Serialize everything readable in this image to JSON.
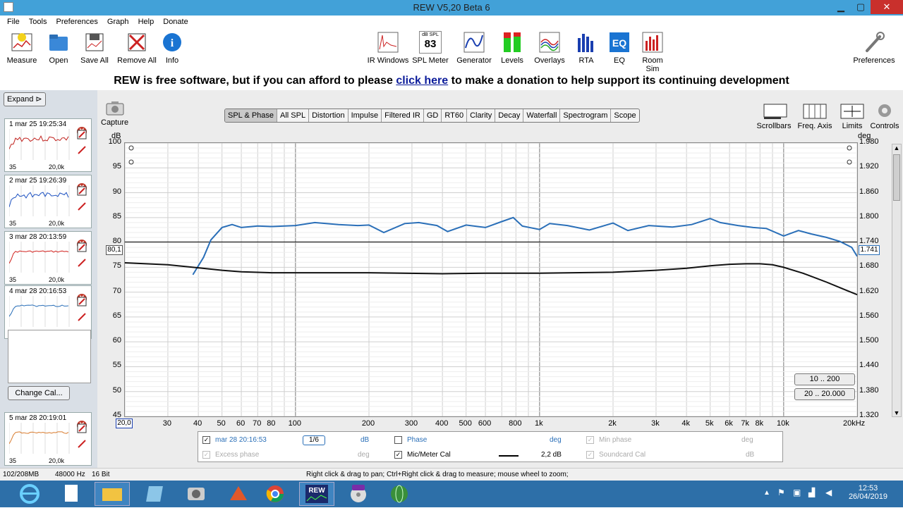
{
  "window": {
    "title": "REW V5,20 Beta 6",
    "minimize": "▁",
    "restore": "▢",
    "close": "✕"
  },
  "menu": [
    "File",
    "Tools",
    "Preferences",
    "Graph",
    "Help",
    "Donate"
  ],
  "toolbar_left": [
    {
      "label": "Measure",
      "icon": "measure-icon"
    },
    {
      "label": "Open",
      "icon": "folder-icon"
    },
    {
      "label": "Save All",
      "icon": "save-icon"
    },
    {
      "label": "Remove All",
      "icon": "remove-all-icon"
    },
    {
      "label": "Info",
      "icon": "info-icon"
    }
  ],
  "toolbar_center": [
    {
      "label": "IR Windows",
      "icon": "ir-windows-icon"
    },
    {
      "label": "SPL Meter",
      "icon": "spl-meter-icon",
      "display_top": "dB SPL",
      "display_value": "83"
    },
    {
      "label": "Generator",
      "icon": "generator-icon"
    },
    {
      "label": "Levels",
      "icon": "levels-icon"
    },
    {
      "label": "Overlays",
      "icon": "overlays-icon"
    },
    {
      "label": "RTA",
      "icon": "rta-icon"
    },
    {
      "label": "EQ",
      "icon": "eq-icon"
    },
    {
      "label": "Room Sim",
      "icon": "room-sim-icon"
    }
  ],
  "toolbar_right": {
    "label": "Preferences",
    "icon": "wrench-icon"
  },
  "donate": {
    "before": "REW is free software, but if you can afford to please",
    "link": "click here",
    "after": "to make a donation to help support its continuing development"
  },
  "left_panel": {
    "expand": "Expand",
    "change_cal": "Change Cal...",
    "measurements": [
      {
        "num": "1",
        "name": "mar 25 19:25:34",
        "color": "#c0201c",
        "x_min": "35",
        "x_max": "20,0k"
      },
      {
        "num": "2",
        "name": "mar 25 19:26:39",
        "color": "#1a4fc0",
        "x_min": "35",
        "x_max": "20,0k"
      },
      {
        "num": "3",
        "name": "mar 28 20:13:59",
        "color": "#d0201c",
        "x_min": "35",
        "x_max": "20,0k"
      },
      {
        "num": "4",
        "name": "mar 28 20:16:53",
        "color": "#2a6fb8",
        "x_min": "35",
        "x_max": "20,0k"
      },
      {
        "num": "5",
        "name": "mar 28 20:19:01",
        "color": "#d87a2c",
        "x_min": "35",
        "x_max": "20,0k"
      }
    ]
  },
  "graph": {
    "capture": "Capture",
    "tabs": [
      "SPL & Phase",
      "All SPL",
      "Distortion",
      "Impulse",
      "Filtered IR",
      "GD",
      "RT60",
      "Clarity",
      "Decay",
      "Waterfall",
      "Spectrogram",
      "Scope"
    ],
    "active_tab": "SPL & Phase",
    "right_tools": [
      "Scrollbars",
      "Freq. Axis",
      "Limits",
      "Controls"
    ],
    "range_buttons": [
      "10 .. 200",
      "20 .. 20.000"
    ],
    "cursor_left": "80,1",
    "cursor_right": "1.741",
    "x_start": "20,0"
  },
  "chart_data": {
    "type": "line",
    "ylabel": "dB",
    "y2label": "deg",
    "x_scale": "log",
    "xlim": [
      20,
      20000
    ],
    "ylim": [
      45,
      100
    ],
    "y2lim": [
      1.32,
      1.98
    ],
    "grid": true,
    "x_ticks": [
      "20,0",
      "30",
      "40",
      "50",
      "60",
      "70",
      "80",
      "100",
      "200",
      "300",
      "400",
      "500",
      "600",
      "800",
      "1k",
      "2k",
      "3k",
      "4k",
      "5k",
      "6k",
      "7k",
      "8k",
      "10k",
      "20kHz"
    ],
    "y_ticks": [
      "100",
      "95",
      "90",
      "85",
      "80",
      "75",
      "70",
      "65",
      "60",
      "55",
      "50",
      "45"
    ],
    "y2_ticks": [
      "1.980",
      "1.920",
      "1.860",
      "1.800",
      "1.740",
      "1.680",
      "1.620",
      "1.560",
      "1.500",
      "1.440",
      "1.380",
      "1.320"
    ],
    "series": [
      {
        "name": "mar 28 20:16:53",
        "color": "#2a6fb8",
        "x": [
          38,
          42,
          45,
          50,
          55,
          60,
          70,
          80,
          100,
          120,
          150,
          180,
          200,
          230,
          280,
          320,
          380,
          420,
          500,
          600,
          700,
          780,
          850,
          1000,
          1100,
          1300,
          1600,
          2000,
          2300,
          2800,
          3500,
          4200,
          5000,
          5500,
          6500,
          7500,
          8500,
          10000,
          11500,
          13000,
          15000,
          17000,
          19000,
          20000
        ],
        "y": [
          73.5,
          77,
          80.5,
          83,
          83.6,
          83,
          83.3,
          83.2,
          83.4,
          84,
          83.6,
          83.4,
          83.5,
          82,
          83.8,
          84,
          83.4,
          82.2,
          83.5,
          83,
          84.2,
          85,
          83.3,
          82.6,
          83.8,
          83.4,
          82.5,
          83.9,
          82.4,
          83.4,
          83.1,
          83.6,
          84.8,
          84,
          83.4,
          83,
          82.8,
          81.3,
          82.4,
          81.7,
          81,
          80.2,
          79,
          77.2
        ]
      },
      {
        "name": "Mic/Meter Cal",
        "color": "#111111",
        "x": [
          20,
          30,
          40,
          50,
          60,
          80,
          100,
          200,
          400,
          600,
          800,
          1000,
          2000,
          3000,
          4000,
          5000,
          6000,
          7000,
          8000,
          9000,
          10000,
          12000,
          15000,
          18000,
          20000
        ],
        "y": [
          75.9,
          75.5,
          74.9,
          74.4,
          74.1,
          73.9,
          73.9,
          73.9,
          73.7,
          73.8,
          73.8,
          73.8,
          74.0,
          74.4,
          74.8,
          75.3,
          75.6,
          75.7,
          75.7,
          75.5,
          75.0,
          73.8,
          72.0,
          70.4,
          69.5
        ]
      }
    ]
  },
  "legend": {
    "meas_name": "mar 28 20:16:53",
    "smoothing": "1/6",
    "meas_unit": "dB",
    "phase": "Phase",
    "phase_unit": "deg",
    "min_phase": "Min phase",
    "min_phase_unit": "deg",
    "excess_phase": "Excess phase",
    "excess_phase_unit": "deg",
    "mic_cal": "Mic/Meter Cal",
    "mic_cal_value": "2,2 dB",
    "soundcard_cal": "Soundcard Cal",
    "soundcard_unit": "dB"
  },
  "status": {
    "memory": "102/208MB",
    "rate": "48000 Hz",
    "bits": "16 Bit",
    "hint": "Right click & drag to pan; Ctrl+Right click & drag to measure; mouse wheel to zoom;"
  },
  "taskbar": {
    "time": "12:53",
    "date": "26/04/2019"
  }
}
